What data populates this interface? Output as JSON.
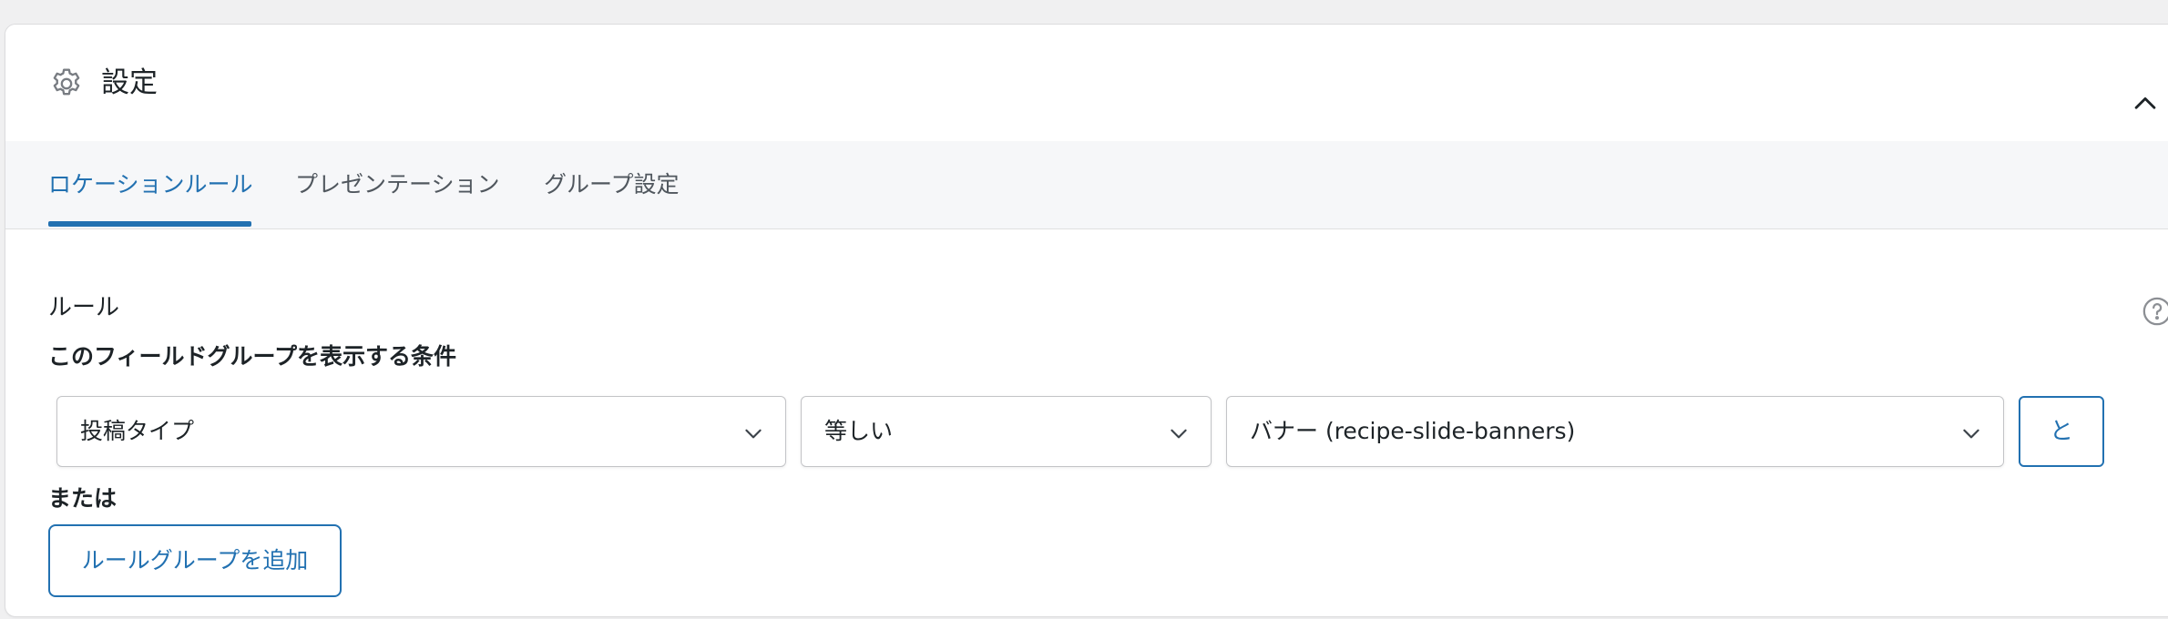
{
  "panel": {
    "title": "設定",
    "title_icon": "gear-icon",
    "collapse_icon": "chevron-up-icon"
  },
  "tabs": [
    {
      "label": "ロケーションルール",
      "active": true
    },
    {
      "label": "プレゼンテーション",
      "active": false
    },
    {
      "label": "グループ設定",
      "active": false
    }
  ],
  "rules": {
    "section_label": "ルール",
    "help_icon": "question-circle-icon",
    "condition_label": "このフィールドグループを表示する条件",
    "param_select": "投稿タイプ",
    "operator_select": "等しい",
    "value_select": "バナー (recipe-slide-banners)",
    "and_button": "と",
    "or_label": "または",
    "add_group_button": "ルールグループを追加"
  },
  "colors": {
    "accent": "#2271b1",
    "text": "#1d2327",
    "muted": "#50575e",
    "border": "#c3c4c7",
    "tab_bar_bg": "#f6f7f9"
  }
}
